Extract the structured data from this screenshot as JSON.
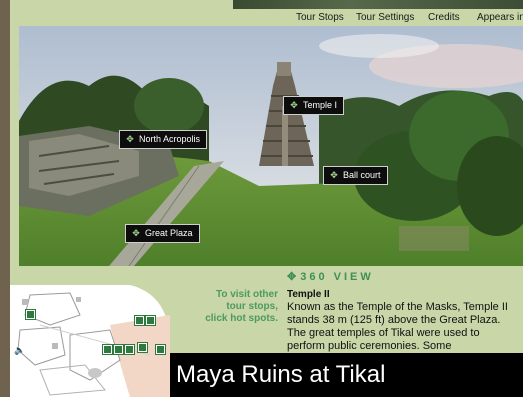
{
  "nav": {
    "items": [
      "Tour Stops",
      "Tour Settings",
      "Credits",
      "Appears in"
    ]
  },
  "hotspots": {
    "temple1": "Temple I",
    "north_acropolis": "North Acropolis",
    "ball_court": "Ball court",
    "great_plaza": "Great Plaza"
  },
  "view": {
    "icon": "✥",
    "label": "360 VIEW"
  },
  "hint": {
    "line1": "To visit other",
    "line2": "tour stops,",
    "line3": "click hot spots."
  },
  "info": {
    "title": "Temple II",
    "body": "Known as the Temple of the Masks, Temple II stands 38 m (125 ft) above the Great Plaza. The great temples of Tikal were used to perform public ceremonies. Some"
  },
  "caption": "Maya Ruins at Tikal",
  "icons": {
    "hotspot": "compass-rose-icon",
    "speaker": "speaker-icon"
  },
  "colors": {
    "accent": "#3f8f56",
    "hotspot_bg": "#0d0d0d",
    "panel_bg": "#c8d6a8"
  }
}
